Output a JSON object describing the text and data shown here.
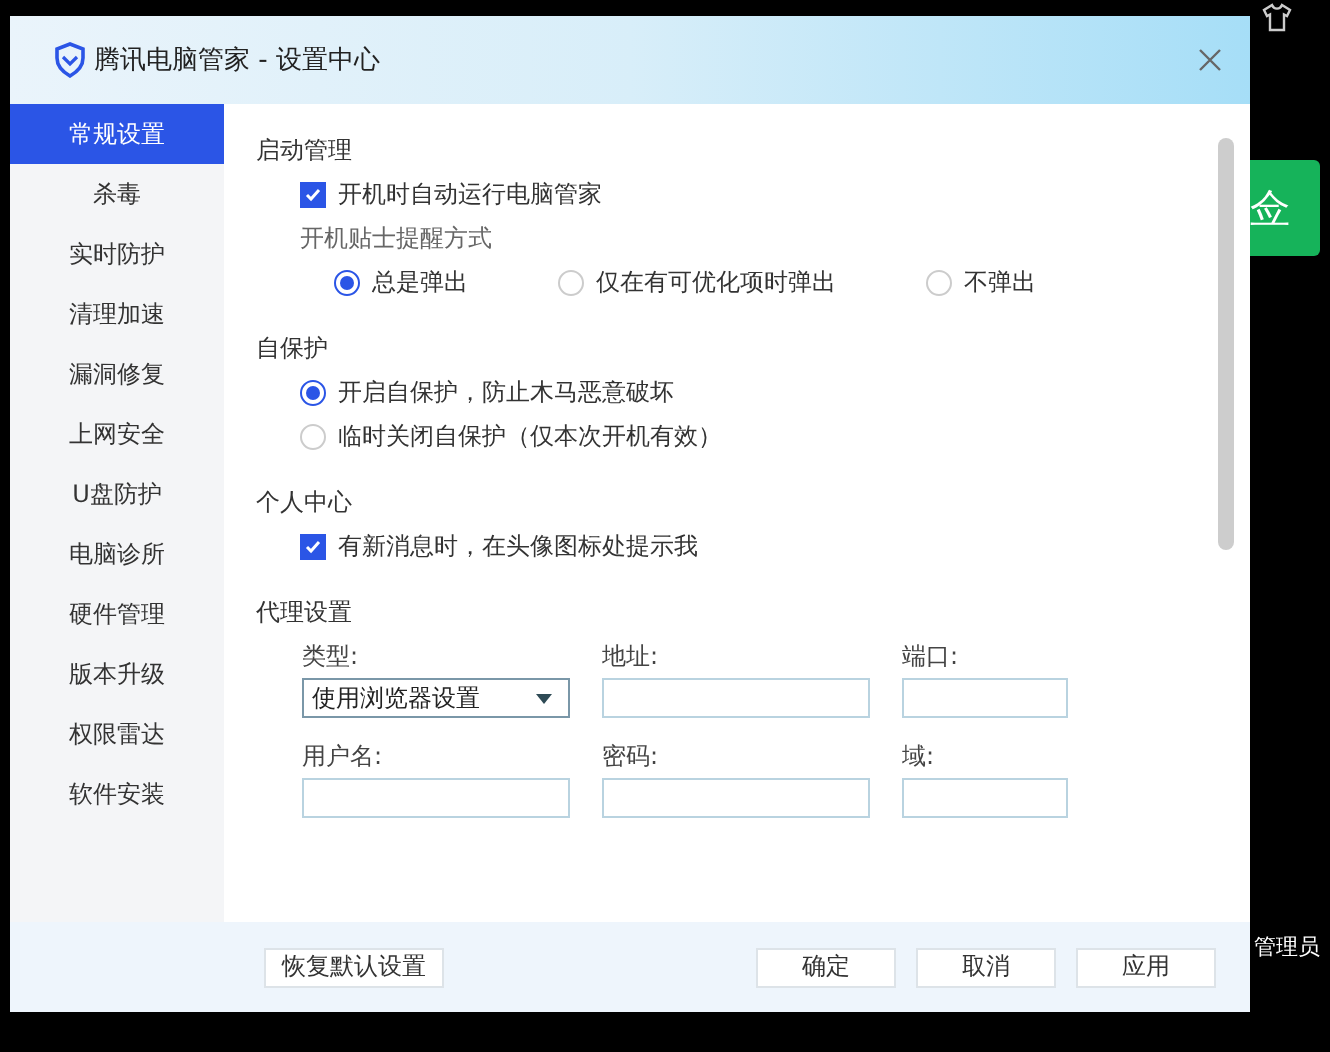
{
  "window": {
    "title": "腾讯电脑管家 - 设置中心"
  },
  "sidebar": {
    "items": [
      {
        "label": "常规设置",
        "selected": true
      },
      {
        "label": "杀毒",
        "selected": false
      },
      {
        "label": "实时防护",
        "selected": false
      },
      {
        "label": "清理加速",
        "selected": false
      },
      {
        "label": "漏洞修复",
        "selected": false
      },
      {
        "label": "上网安全",
        "selected": false
      },
      {
        "label": "U盘防护",
        "selected": false
      },
      {
        "label": "电脑诊所",
        "selected": false
      },
      {
        "label": "硬件管理",
        "selected": false
      },
      {
        "label": "版本升级",
        "selected": false
      },
      {
        "label": "权限雷达",
        "selected": false
      },
      {
        "label": "软件安装",
        "selected": false
      }
    ]
  },
  "sections": [
    {
      "title": "启动管理",
      "items": [
        {
          "kind": "checkbox",
          "label": "开机时自动运行电脑管家",
          "checked": true
        },
        {
          "kind": "caption",
          "label": "开机贴士提醒方式"
        },
        {
          "kind": "radio_row",
          "options": [
            {
              "label": "总是弹出",
              "selected": true
            },
            {
              "label": "仅在有可优化项时弹出",
              "selected": false
            },
            {
              "label": "不弹出",
              "selected": false
            }
          ]
        }
      ]
    },
    {
      "title": "自保护",
      "items": [
        {
          "kind": "radio",
          "label": "开启自保护，防止木马恶意破坏",
          "selected": true
        },
        {
          "kind": "radio",
          "label": "临时关闭自保护（仅本次开机有效）",
          "selected": false
        }
      ]
    },
    {
      "title": "个人中心",
      "items": [
        {
          "kind": "checkbox",
          "label": "有新消息时，在头像图标处提示我",
          "checked": true
        }
      ]
    },
    {
      "title": "代理设置",
      "items": [
        {
          "kind": "fields",
          "fields": [
            {
              "label": "类型:",
              "kind": "dropdown",
              "value": "使用浏览器设置"
            },
            {
              "label": "地址:",
              "kind": "text"
            },
            {
              "label": "端口:",
              "kind": "short_text"
            },
            {
              "label": "用户名:",
              "kind": "text"
            },
            {
              "label": "密码:",
              "kind": "text"
            },
            {
              "label": "域:",
              "kind": "short_text"
            }
          ]
        }
      ]
    }
  ],
  "footer": {
    "buttons": [
      {
        "label": "恢复默认设置",
        "kind": "left"
      },
      {
        "label": "确定",
        "kind": "right"
      },
      {
        "label": "取消",
        "kind": "right"
      },
      {
        "label": "应用",
        "kind": "right"
      }
    ]
  },
  "desktop": {
    "side_button": "佥",
    "side_text": "管理员"
  }
}
